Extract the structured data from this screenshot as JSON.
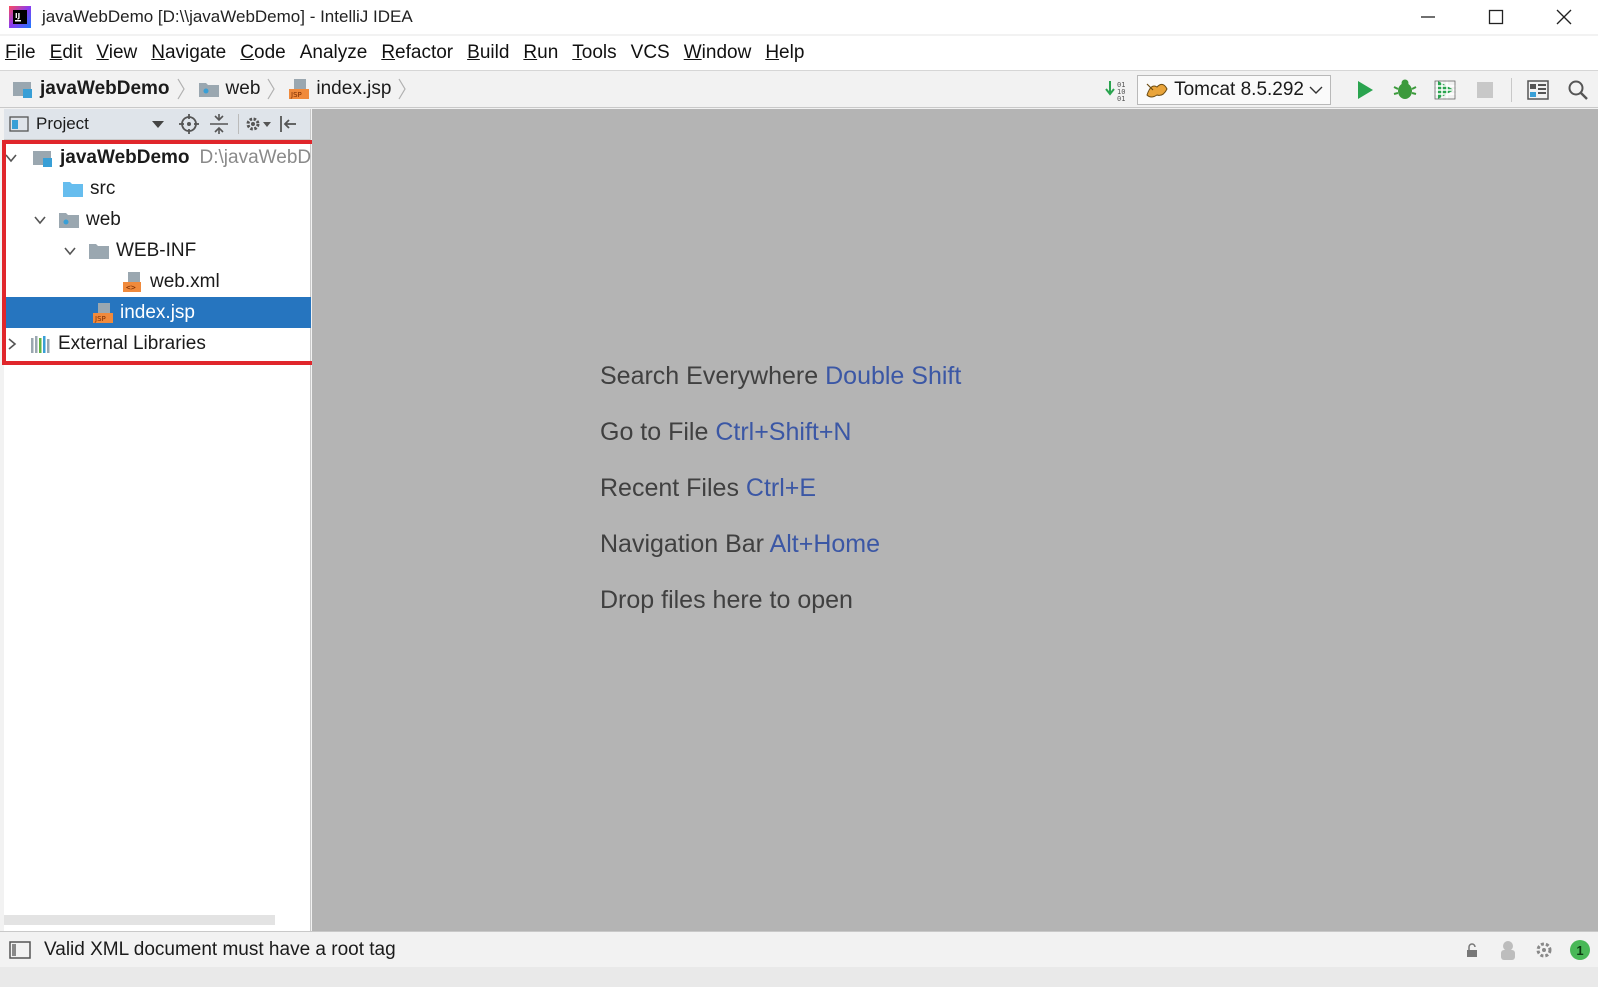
{
  "window": {
    "title": "javaWebDemo [D:\\\\javaWebDemo] - IntelliJ IDEA"
  },
  "menu": [
    {
      "label": "File",
      "mnemonic": "F",
      "rest": "ile"
    },
    {
      "label": "Edit",
      "mnemonic": "E",
      "rest": "dit"
    },
    {
      "label": "View",
      "mnemonic": "V",
      "rest": "iew"
    },
    {
      "label": "Navigate",
      "mnemonic": "N",
      "rest": "avigate"
    },
    {
      "label": "Code",
      "mnemonic": "C",
      "rest": "ode"
    },
    {
      "label": "Analyze",
      "mnemonic": "",
      "rest": "Analyze"
    },
    {
      "label": "Refactor",
      "mnemonic": "R",
      "rest": "efactor"
    },
    {
      "label": "Build",
      "mnemonic": "B",
      "rest": "uild"
    },
    {
      "label": "Run",
      "mnemonic": "R",
      "rest": "un"
    },
    {
      "label": "Tools",
      "mnemonic": "T",
      "rest": "ools"
    },
    {
      "label": "VCS",
      "mnemonic": "",
      "rest": "VCS"
    },
    {
      "label": "Window",
      "mnemonic": "W",
      "rest": "indow"
    },
    {
      "label": "Help",
      "mnemonic": "H",
      "rest": "elp"
    }
  ],
  "breadcrumb": [
    {
      "label": "javaWebDemo",
      "icon": "module-icon"
    },
    {
      "label": "web",
      "icon": "web-folder-icon"
    },
    {
      "label": "index.jsp",
      "icon": "jsp-file-icon"
    }
  ],
  "toolbar": {
    "run_config": "Tomcat 8.5.292",
    "icons": [
      "build-icon",
      "run-icon",
      "debug-icon",
      "coverage-icon",
      "stop-icon",
      "project-structure-icon",
      "search-icon"
    ],
    "colors": {
      "run": "#2aa44f",
      "debug": "#3c9a3c",
      "stop": "#c8c8c8"
    }
  },
  "project_panel": {
    "title": "Project",
    "tree": [
      {
        "label": "javaWebDemo",
        "hint": "D:\\javaWebDemo",
        "icon": "module-icon",
        "expanded": true,
        "bold": true
      },
      {
        "label": "src",
        "icon": "source-folder-icon"
      },
      {
        "label": "web",
        "icon": "web-folder-icon",
        "expanded": true
      },
      {
        "label": "WEB-INF",
        "icon": "folder-icon",
        "expanded": true
      },
      {
        "label": "web.xml",
        "icon": "xml-file-icon"
      },
      {
        "label": "index.jsp",
        "icon": "jsp-file-icon",
        "selected": true
      },
      {
        "label": "External Libraries",
        "icon": "libraries-icon",
        "expanded": false
      }
    ],
    "highlight_color": "#e0262b",
    "selection_color": "#2675bf"
  },
  "editor": {
    "hints": [
      {
        "text": "Search Everywhere",
        "key": "Double Shift"
      },
      {
        "text": "Go to File",
        "key": "Ctrl+Shift+N"
      },
      {
        "text": "Recent Files",
        "key": "Ctrl+E"
      },
      {
        "text": "Navigation Bar",
        "key": "Alt+Home"
      },
      {
        "text": "Drop files here to open",
        "key": ""
      }
    ]
  },
  "status": {
    "message": "Valid XML document must have a root tag",
    "notification_count": "1"
  }
}
